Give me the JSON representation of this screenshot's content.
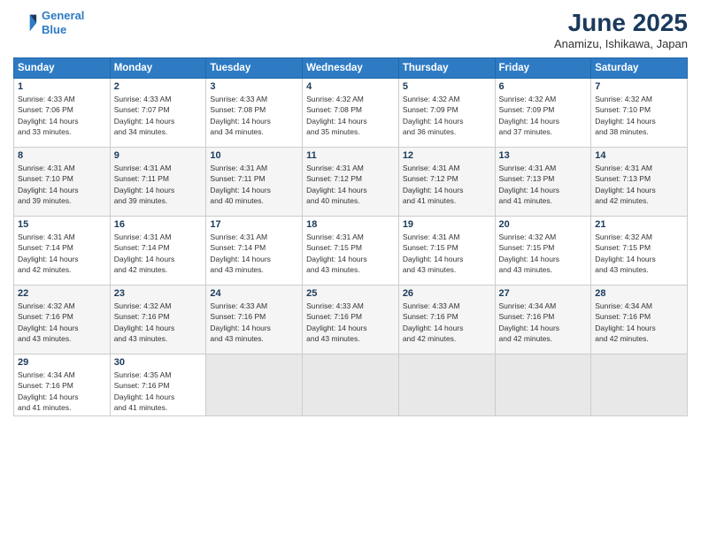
{
  "header": {
    "logo_line1": "General",
    "logo_line2": "Blue",
    "main_title": "June 2025",
    "subtitle": "Anamizu, Ishikawa, Japan"
  },
  "calendar": {
    "days_of_week": [
      "Sunday",
      "Monday",
      "Tuesday",
      "Wednesday",
      "Thursday",
      "Friday",
      "Saturday"
    ],
    "weeks": [
      [
        {
          "day": "",
          "info": ""
        },
        {
          "day": "2",
          "info": "Sunrise: 4:33 AM\nSunset: 7:07 PM\nDaylight: 14 hours\nand 34 minutes."
        },
        {
          "day": "3",
          "info": "Sunrise: 4:33 AM\nSunset: 7:08 PM\nDaylight: 14 hours\nand 34 minutes."
        },
        {
          "day": "4",
          "info": "Sunrise: 4:32 AM\nSunset: 7:08 PM\nDaylight: 14 hours\nand 35 minutes."
        },
        {
          "day": "5",
          "info": "Sunrise: 4:32 AM\nSunset: 7:09 PM\nDaylight: 14 hours\nand 36 minutes."
        },
        {
          "day": "6",
          "info": "Sunrise: 4:32 AM\nSunset: 7:09 PM\nDaylight: 14 hours\nand 37 minutes."
        },
        {
          "day": "7",
          "info": "Sunrise: 4:32 AM\nSunset: 7:10 PM\nDaylight: 14 hours\nand 38 minutes."
        }
      ],
      [
        {
          "day": "1",
          "info": "Sunrise: 4:33 AM\nSunset: 7:06 PM\nDaylight: 14 hours\nand 33 minutes.",
          "first_col": true
        },
        {
          "day": "8",
          "info": "Sunrise: 4:31 AM\nSunset: 7:10 PM\nDaylight: 14 hours\nand 39 minutes."
        },
        {
          "day": "9",
          "info": "Sunrise: 4:31 AM\nSunset: 7:11 PM\nDaylight: 14 hours\nand 39 minutes."
        },
        {
          "day": "10",
          "info": "Sunrise: 4:31 AM\nSunset: 7:11 PM\nDaylight: 14 hours\nand 40 minutes."
        },
        {
          "day": "11",
          "info": "Sunrise: 4:31 AM\nSunset: 7:12 PM\nDaylight: 14 hours\nand 40 minutes."
        },
        {
          "day": "12",
          "info": "Sunrise: 4:31 AM\nSunset: 7:12 PM\nDaylight: 14 hours\nand 41 minutes."
        },
        {
          "day": "13",
          "info": "Sunrise: 4:31 AM\nSunset: 7:13 PM\nDaylight: 14 hours\nand 41 minutes."
        },
        {
          "day": "14",
          "info": "Sunrise: 4:31 AM\nSunset: 7:13 PM\nDaylight: 14 hours\nand 42 minutes."
        }
      ],
      [
        {
          "day": "15",
          "info": "Sunrise: 4:31 AM\nSunset: 7:14 PM\nDaylight: 14 hours\nand 42 minutes."
        },
        {
          "day": "16",
          "info": "Sunrise: 4:31 AM\nSunset: 7:14 PM\nDaylight: 14 hours\nand 42 minutes."
        },
        {
          "day": "17",
          "info": "Sunrise: 4:31 AM\nSunset: 7:14 PM\nDaylight: 14 hours\nand 43 minutes."
        },
        {
          "day": "18",
          "info": "Sunrise: 4:31 AM\nSunset: 7:15 PM\nDaylight: 14 hours\nand 43 minutes."
        },
        {
          "day": "19",
          "info": "Sunrise: 4:31 AM\nSunset: 7:15 PM\nDaylight: 14 hours\nand 43 minutes."
        },
        {
          "day": "20",
          "info": "Sunrise: 4:32 AM\nSunset: 7:15 PM\nDaylight: 14 hours\nand 43 minutes."
        },
        {
          "day": "21",
          "info": "Sunrise: 4:32 AM\nSunset: 7:15 PM\nDaylight: 14 hours\nand 43 minutes."
        }
      ],
      [
        {
          "day": "22",
          "info": "Sunrise: 4:32 AM\nSunset: 7:16 PM\nDaylight: 14 hours\nand 43 minutes."
        },
        {
          "day": "23",
          "info": "Sunrise: 4:32 AM\nSunset: 7:16 PM\nDaylight: 14 hours\nand 43 minutes."
        },
        {
          "day": "24",
          "info": "Sunrise: 4:33 AM\nSunset: 7:16 PM\nDaylight: 14 hours\nand 43 minutes."
        },
        {
          "day": "25",
          "info": "Sunrise: 4:33 AM\nSunset: 7:16 PM\nDaylight: 14 hours\nand 43 minutes."
        },
        {
          "day": "26",
          "info": "Sunrise: 4:33 AM\nSunset: 7:16 PM\nDaylight: 14 hours\nand 42 minutes."
        },
        {
          "day": "27",
          "info": "Sunrise: 4:34 AM\nSunset: 7:16 PM\nDaylight: 14 hours\nand 42 minutes."
        },
        {
          "day": "28",
          "info": "Sunrise: 4:34 AM\nSunset: 7:16 PM\nDaylight: 14 hours\nand 42 minutes."
        }
      ],
      [
        {
          "day": "29",
          "info": "Sunrise: 4:34 AM\nSunset: 7:16 PM\nDaylight: 14 hours\nand 41 minutes."
        },
        {
          "day": "30",
          "info": "Sunrise: 4:35 AM\nSunset: 7:16 PM\nDaylight: 14 hours\nand 41 minutes."
        },
        {
          "day": "",
          "info": ""
        },
        {
          "day": "",
          "info": ""
        },
        {
          "day": "",
          "info": ""
        },
        {
          "day": "",
          "info": ""
        },
        {
          "day": "",
          "info": ""
        }
      ]
    ]
  }
}
